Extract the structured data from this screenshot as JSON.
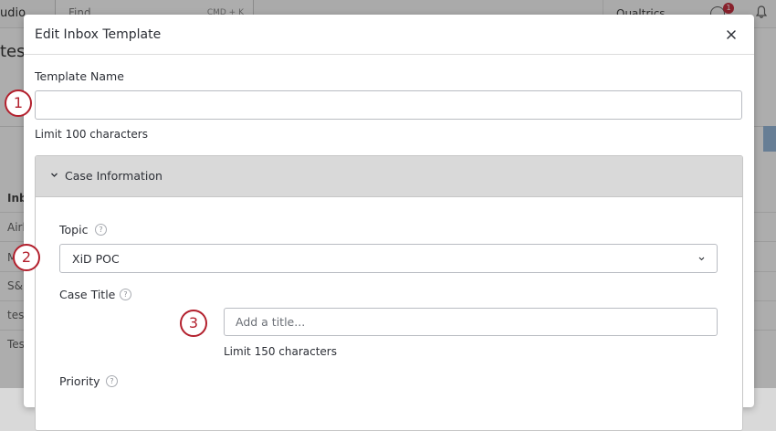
{
  "background": {
    "brand_partial": "udio",
    "find_label": "Find",
    "find_shortcut": "CMD + K",
    "org_label": "Qualtrics",
    "notification_count": "1",
    "page_title_partial": "tes",
    "column_header_partial": "Inb",
    "rows_partial": [
      "Airl",
      "M",
      "S&",
      "test",
      "Tes"
    ]
  },
  "modal": {
    "title": "Edit Inbox Template",
    "close_icon": "close-icon",
    "template_name": {
      "label": "Template Name",
      "value": "",
      "hint": "Limit 100 characters"
    },
    "case_section": {
      "title": "Case Information",
      "expanded": true,
      "topic": {
        "label": "Topic",
        "selected": "XiD POC"
      },
      "case_title": {
        "label": "Case Title",
        "placeholder": "Add a title...",
        "value": "",
        "hint": "Limit 150 characters"
      },
      "priority": {
        "label": "Priority"
      }
    }
  },
  "callouts": [
    "1",
    "2",
    "3"
  ],
  "colors": {
    "callout": "#b3202d",
    "section_header": "#d9d9d9",
    "badge": "#c41e2f"
  }
}
